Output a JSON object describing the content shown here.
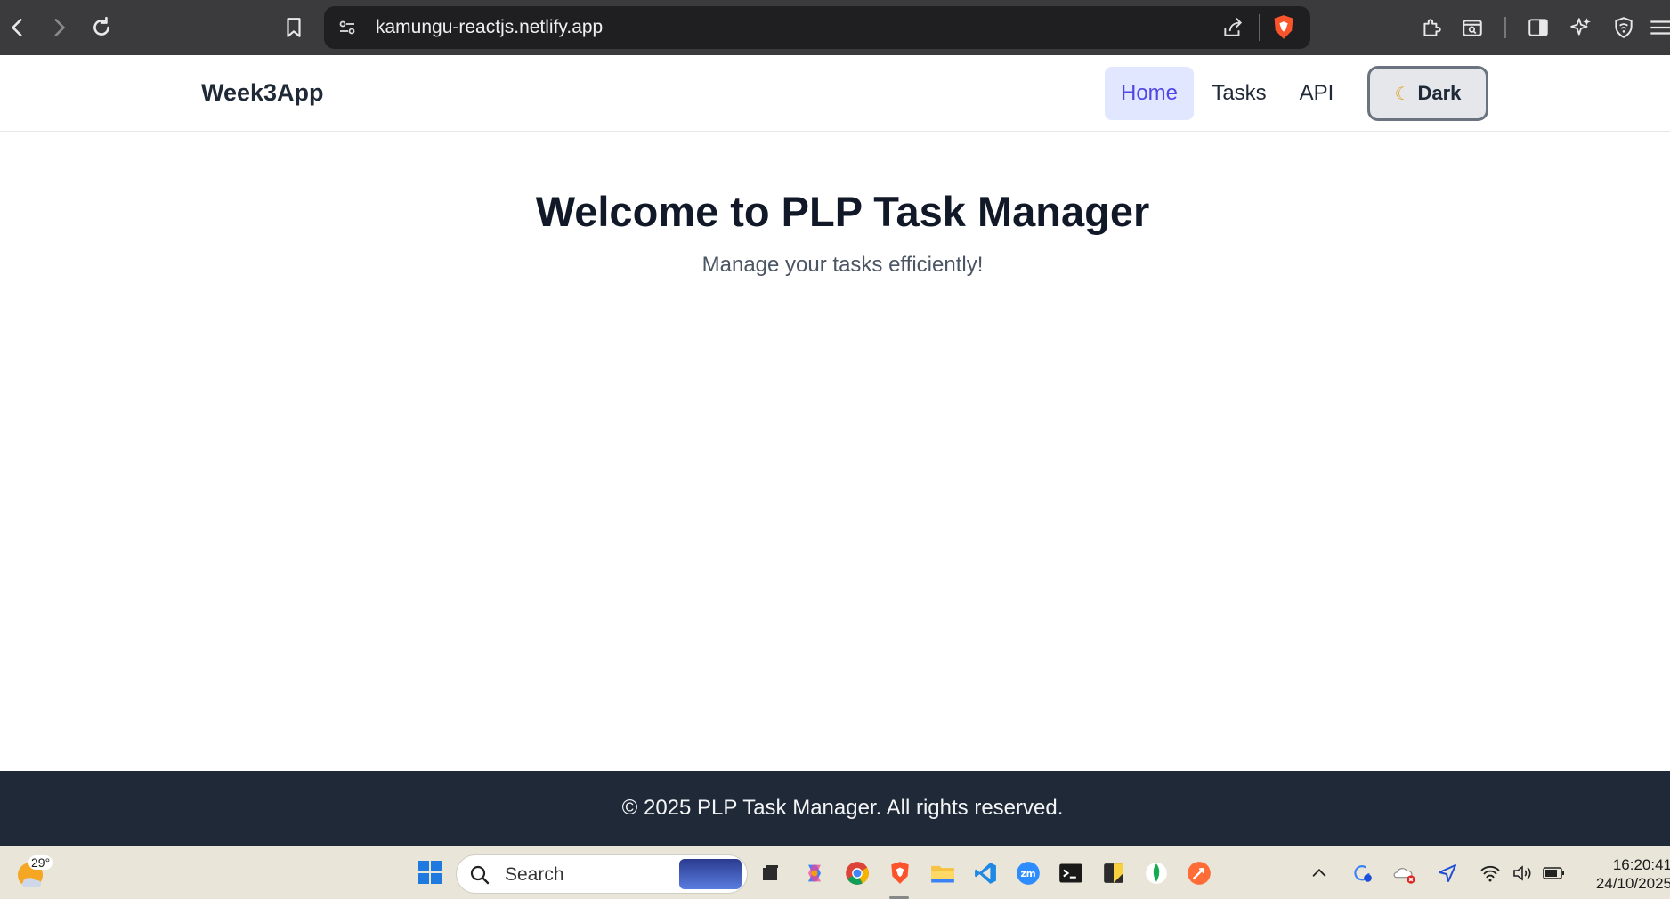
{
  "browser": {
    "url": "kamungu-reactjs.netlify.app"
  },
  "navbar": {
    "brand": "Week3App",
    "links": [
      {
        "label": "Home",
        "active": true
      },
      {
        "label": "Tasks",
        "active": false
      },
      {
        "label": "API",
        "active": false
      }
    ],
    "theme_toggle": {
      "icon": "moon-icon",
      "label": "Dark"
    }
  },
  "hero": {
    "title": "Welcome to PLP Task Manager",
    "subtitle": "Manage your tasks efficiently!"
  },
  "footer": {
    "text": "© 2025 PLP Task Manager. All rights reserved."
  },
  "taskbar": {
    "weather_temp": "29°",
    "search_placeholder": "Search",
    "apps": [
      "file-explorer-icon",
      "copilot-icon",
      "chrome-icon",
      "brave-icon",
      "folder-icon",
      "vscode-icon",
      "zoom-icon",
      "terminal-icon",
      "sticky-notes-icon",
      "mongodb-icon",
      "postman-icon"
    ],
    "time": "16:20:41",
    "date": "24/10/2025"
  },
  "colors": {
    "accent": "#4f46e5",
    "active_bg": "#e0e7ff",
    "footer_bg": "#1f2937",
    "chrome_bg": "#3b3b3d"
  }
}
